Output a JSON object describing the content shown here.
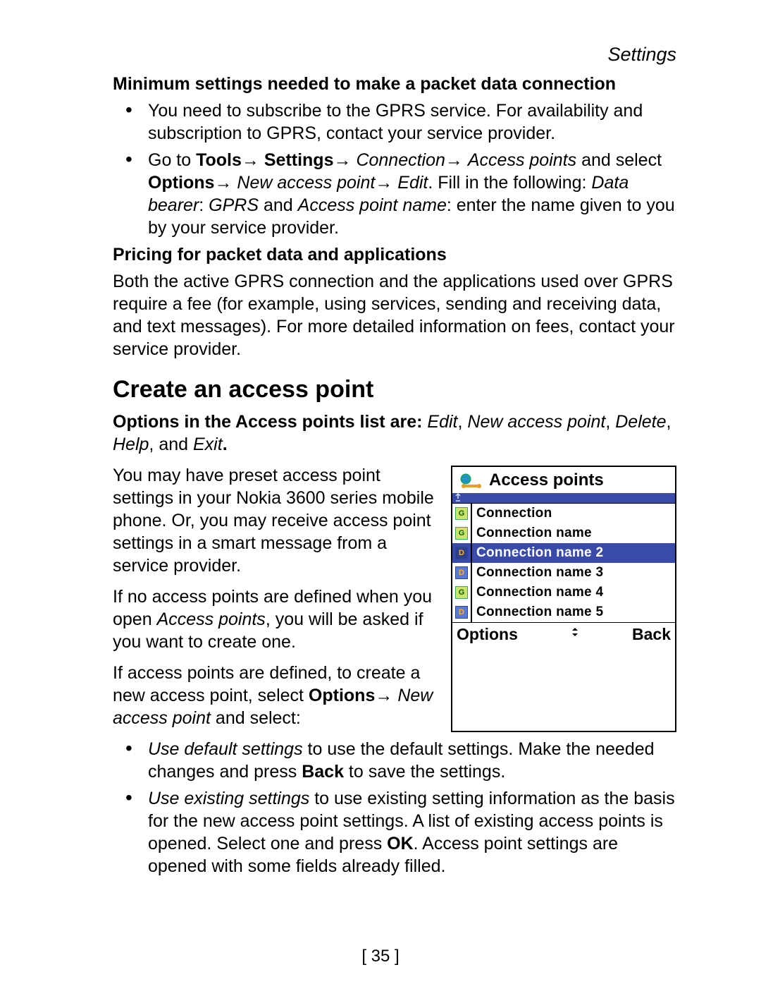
{
  "section_tag": "Settings",
  "sub1": "Minimum settings needed to make a packet data connection",
  "b1a": "You need to subscribe to the GPRS service. For availability and subscription to GPRS, contact your service provider.",
  "b2": {
    "pre": "Go to ",
    "tools": "Tools",
    "arrow": "→ ",
    "settings": "Settings",
    "connection": "Connection",
    "access_points": "Access points",
    "and_select": " and select ",
    "options": "Options",
    "nap": "New access point",
    "edit": "Edit",
    "fillin": ". Fill in the following: ",
    "db": "Data bearer",
    "colon": ": ",
    "gprs": "GPRS",
    "and": " and ",
    "apn": "Access point name",
    "tail": ": enter the name given to you by your service provider."
  },
  "sub2": "Pricing for packet data and applications",
  "pricing_para": "Both the active GPRS connection and the applications used over GPRS require a fee (for example, using services, sending and receiving data, and text messages). For more detailed information on fees, contact your service provider.",
  "h2": "Create an access point",
  "opts": {
    "lead": "Options in the Access points list are: ",
    "o1": "Edit",
    "o2": "New access point",
    "o3": "Delete",
    "o4": "Help",
    "and": "and ",
    "o5": "Exit",
    "period": "."
  },
  "p1": "You may have preset access point settings in your Nokia 3600 series mobile phone. Or, you may receive access point settings in a smart message from a service provider.",
  "p2a": "If no access points are defined when you open ",
  "p2_italic": "Access points",
  "p2b": ", you will be asked if you want to create one.",
  "p3a": "If access points are defined, to create a new access point, select ",
  "p3_options": "Options",
  "p3_arrow": "→ ",
  "p3_nap": "New access point",
  "p3_tail": " and select:",
  "l1": {
    "lead": "Use default settings",
    "mid": " to use the default settings. Make the needed changes and press ",
    "back": "Back",
    "tail": " to save the settings."
  },
  "l2": {
    "lead": "Use existing settings",
    "mid": " to use existing setting information as the basis for the new access point settings. A list of existing access points is opened. Select one and press ",
    "ok": "OK",
    "tail": ". Access point settings are opened with some fields already filled."
  },
  "phone": {
    "title": "Access points",
    "rows": [
      {
        "icon": "G",
        "label": "Connection",
        "selected": false
      },
      {
        "icon": "G",
        "label": "Connection name",
        "selected": false
      },
      {
        "icon": "D",
        "label": "Connection name 2",
        "selected": true
      },
      {
        "icon": "D",
        "label": "Connection name 3",
        "selected": false
      },
      {
        "icon": "G",
        "label": "Connection name 4",
        "selected": false
      },
      {
        "icon": "D",
        "label": "Connection name 5",
        "selected": false
      }
    ],
    "soft_left": "Options",
    "soft_right": "Back"
  },
  "page_number": "[ 35 ]"
}
